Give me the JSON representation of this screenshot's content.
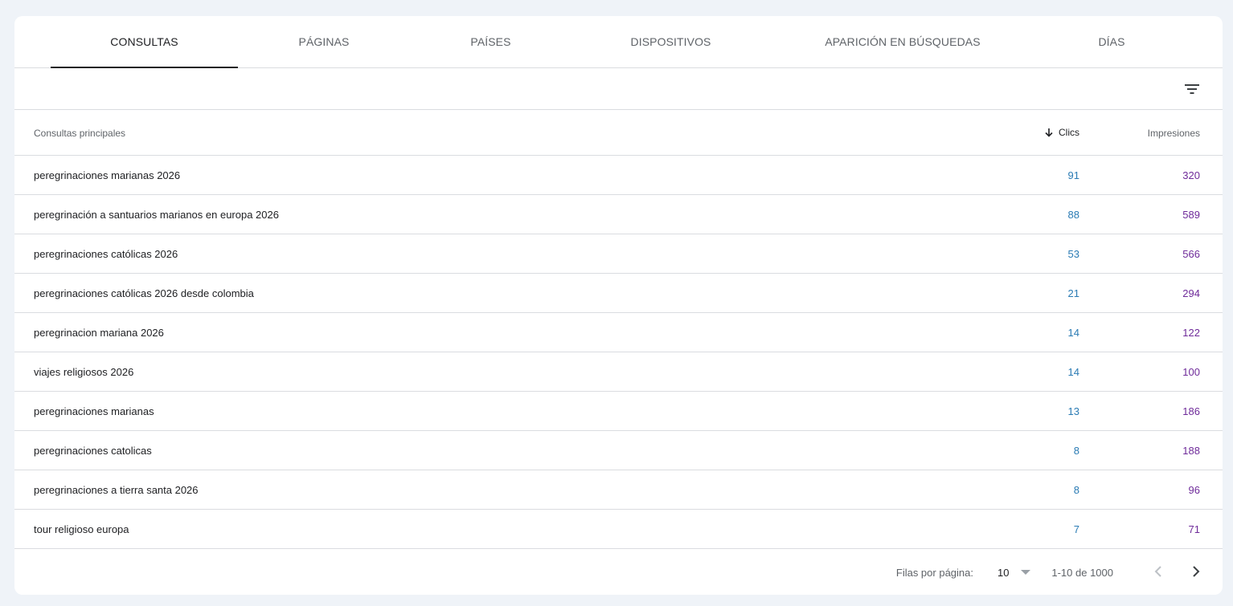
{
  "tabs": [
    {
      "label": "CONSULTAS",
      "active": true
    },
    {
      "label": "PÁGINAS",
      "active": false
    },
    {
      "label": "PAÍSES",
      "active": false
    },
    {
      "label": "DISPOSITIVOS",
      "active": false
    },
    {
      "label": "APARICIÓN EN BÚSQUEDAS",
      "active": false
    },
    {
      "label": "DÍAS",
      "active": false
    }
  ],
  "toolbar": {
    "filter_icon": "filter-list-icon"
  },
  "table": {
    "headers": {
      "query": "Consultas principales",
      "clicks": "Clics",
      "impressions": "Impresiones"
    },
    "sort_icon": "arrow-down-icon",
    "rows": [
      {
        "query": "peregrinaciones marianas 2026",
        "clicks": "91",
        "impressions": "320"
      },
      {
        "query": "peregrinación a santuarios marianos en europa 2026",
        "clicks": "88",
        "impressions": "589"
      },
      {
        "query": "peregrinaciones católicas 2026",
        "clicks": "53",
        "impressions": "566"
      },
      {
        "query": "peregrinaciones católicas 2026 desde colombia",
        "clicks": "21",
        "impressions": "294"
      },
      {
        "query": "peregrinacion mariana 2026",
        "clicks": "14",
        "impressions": "122"
      },
      {
        "query": "viajes religiosos 2026",
        "clicks": "14",
        "impressions": "100"
      },
      {
        "query": "peregrinaciones marianas",
        "clicks": "13",
        "impressions": "186"
      },
      {
        "query": "peregrinaciones catolicas",
        "clicks": "8",
        "impressions": "188"
      },
      {
        "query": "peregrinaciones a tierra santa 2026",
        "clicks": "8",
        "impressions": "96"
      },
      {
        "query": "tour religioso europa",
        "clicks": "7",
        "impressions": "71"
      }
    ]
  },
  "footer": {
    "rows_per_page_label": "Filas por página:",
    "rows_per_page_value": "10",
    "range_text": "1-10 de 1000"
  },
  "colors": {
    "clicks": "#2a7bb4",
    "impressions": "#6f2b9a",
    "background": "#eff3f8"
  }
}
